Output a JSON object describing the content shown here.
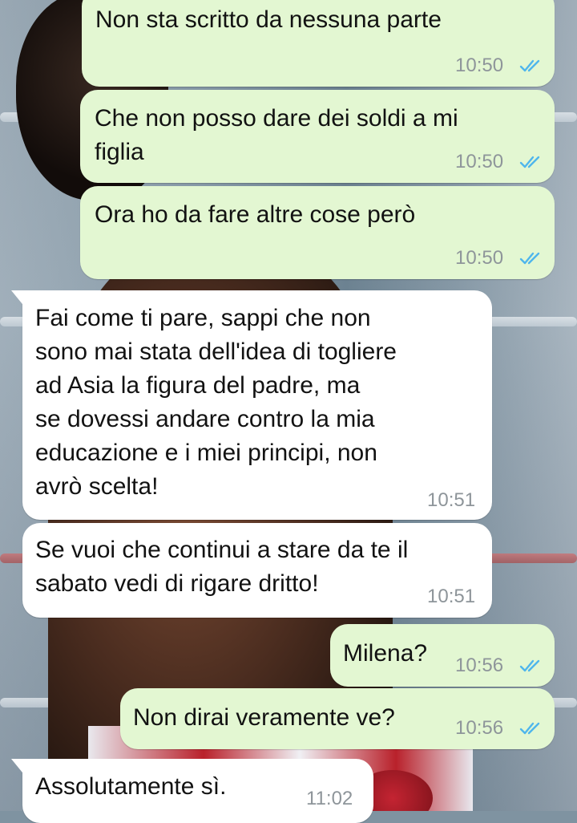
{
  "chat": {
    "messages": [
      {
        "direction": "outgoing",
        "text": "Non sta scritto da nessuna parte",
        "time": "10:50",
        "status": "read"
      },
      {
        "direction": "outgoing",
        "text": "Che non posso dare dei soldi a mi\nfiglia",
        "time": "10:50",
        "status": "read"
      },
      {
        "direction": "outgoing",
        "text": "Ora ho da fare altre cose però",
        "time": "10:50",
        "status": "read"
      },
      {
        "direction": "incoming",
        "text": "Fai come ti pare, sappi che non\nsono mai stata dell'idea di togliere\nad Asia la figura del padre, ma\nse dovessi andare contro la mia\neducazione e i miei principi, non\navrò scelta!",
        "time": "10:51"
      },
      {
        "direction": "incoming",
        "text": "Se vuoi che continui a stare da te il\nsabato vedi di rigare dritto!",
        "time": "10:51"
      },
      {
        "direction": "outgoing",
        "text": "Milena?",
        "time": "10:56",
        "status": "read"
      },
      {
        "direction": "outgoing",
        "text": "Non dirai veramente ve?",
        "time": "10:56",
        "status": "read"
      },
      {
        "direction": "incoming",
        "text": "Assolutamente sì.",
        "time": "11:02"
      }
    ]
  },
  "colors": {
    "outgoing_bubble": "#e3f7d2",
    "incoming_bubble": "#ffffff",
    "read_ticks": "#4fb6ec",
    "time_text": "#8e959a"
  },
  "icons": {
    "read_receipt": "double-check-icon"
  }
}
